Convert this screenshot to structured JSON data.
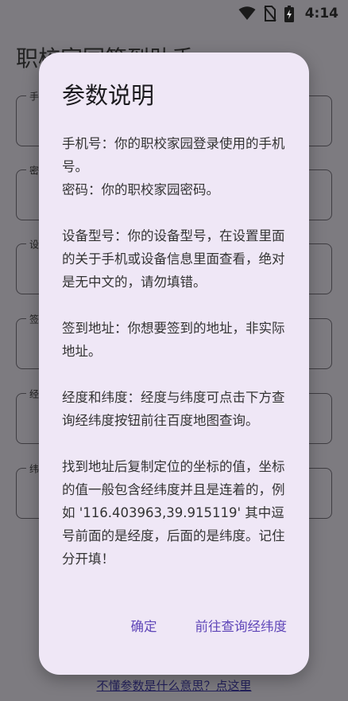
{
  "status_bar": {
    "time": "4:14",
    "icons": [
      "wifi-icon",
      "no-sim-icon",
      "battery-charging-icon"
    ]
  },
  "background": {
    "app_title": "职校家园签到助手",
    "fields": [
      {
        "label": "手机号"
      },
      {
        "label": "密码"
      },
      {
        "label": "设备型号"
      },
      {
        "label": "签到地址"
      },
      {
        "label": "经度"
      },
      {
        "label": "纬度"
      }
    ],
    "help_link": "不懂参数是什么意思？点这里"
  },
  "dialog": {
    "title": "参数说明",
    "lines": {
      "phone": "手机号：你的职校家园登录使用的手机号。",
      "password": "密码：你的职校家园密码。",
      "device": "设备型号：你的设备型号，在设置里面的关于手机或设备信息里面查看，绝对是无中文的，请勿填错。",
      "address": "签到地址：你想要签到的地址，非实际地址。",
      "lnglat": "经度和纬度：经度与纬度可点击下方查询经纬度按钮前往百度地图查询。",
      "note": "找到地址后复制定位的坐标的值，坐标的值一般包含经纬度并且是连着的，例如 '116.403963,39.915119' 其中逗号前面的是经度，后面的是纬度。记住分开填！"
    },
    "confirm_label": "确定",
    "query_label": "前往查询经纬度"
  }
}
